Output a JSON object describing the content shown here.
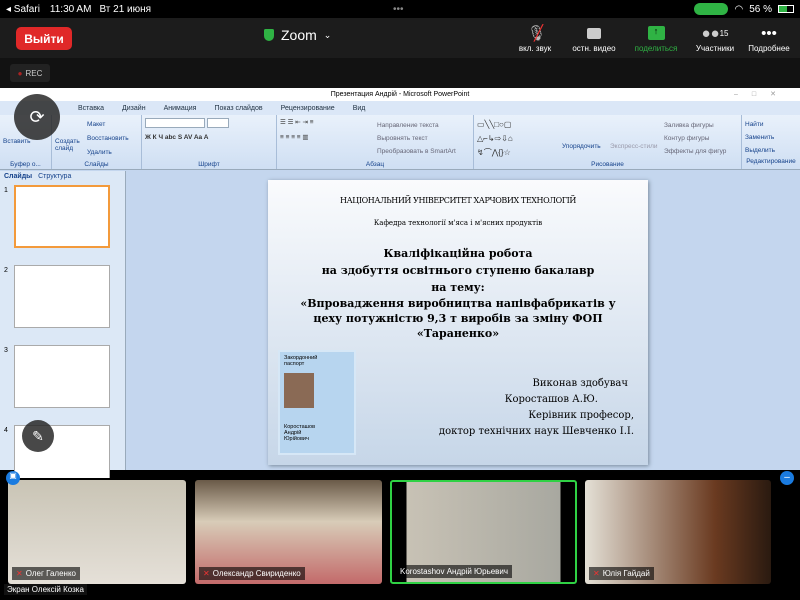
{
  "status": {
    "back": "◂ Safari",
    "time": "11:30 AM",
    "date": "Вт 21 июня",
    "battery": "56 %"
  },
  "zoom": {
    "leave": "Выйти",
    "title": "Zoom",
    "tools": [
      {
        "label": "вкл. звук",
        "icon": "mic-muted-icon"
      },
      {
        "label": "остн. видео",
        "icon": "video-icon"
      },
      {
        "label": "поделиться",
        "icon": "share-icon"
      },
      {
        "label": "Участники",
        "icon": "participants-icon",
        "badge": "15"
      },
      {
        "label": "Подробнее",
        "icon": "more-icon"
      }
    ],
    "rec": "REC"
  },
  "ppt": {
    "title": "Презентация Андрій - Microsoft PowerPoint",
    "tabs": [
      "Вставка",
      "Дизайн",
      "Анимация",
      "Показ слайдов",
      "Рецензирование",
      "Вид"
    ],
    "groups": {
      "clipboard": "Буфер о...",
      "slides": "Слайды",
      "font": "Шрифт",
      "paragraph": "Абзац",
      "drawing": "Рисование",
      "editing": "Редактирование"
    },
    "buttons": {
      "paste": "Вставить",
      "create": "Создать слайд",
      "layout": "Макет",
      "reset": "Восстановить",
      "delete": "Удалить",
      "text_dir": "Направление текста",
      "align_text": "Выровнять текст",
      "smartart": "Преобразовать в SmartArt",
      "arrange": "Упорядочить",
      "quick": "Экспресс-стили",
      "fill": "Заливка фигуры",
      "outline": "Контур фигуры",
      "effects": "Эффекты для фигур",
      "find": "Найти",
      "replace": "Заменить",
      "select": "Выделить"
    },
    "pane_tabs": [
      "Слайды",
      "Структура"
    ],
    "thumbs": [
      "1",
      "2",
      "3",
      "4"
    ]
  },
  "slide": {
    "uni": "НАЦІОНАЛЬНИЙ УНІВЕРСИТЕТ ХАРЧОВИХ ТЕХНОЛОГІЙ",
    "dept": "Кафедра технології м'яса і м'ясних продуктів",
    "l1": "Кваліфікаційна робота",
    "l2": "на здобуття освітнього ступеню бакалавр",
    "l3": "на тему:",
    "l4": "«Впровадження виробництва напівфабрикатів у",
    "l5": "цеху потужністю 9,3 т виробів за зміну ФОП",
    "l6": "«Тараненко»",
    "passport": {
      "title": "Закордонний паспорт",
      "name": "Коросташов Андрій Юрійович"
    },
    "a1": "Виконав здобувач",
    "a2": "Коросташов А.Ю.",
    "a3": "Керівник  професор,",
    "a4": "доктор технічних наук  Шевченко І.І."
  },
  "videos": [
    {
      "name": "Олег Галенко",
      "muted": true
    },
    {
      "name": "Олександр Свириденко",
      "muted": true
    },
    {
      "name": "Korostashov Андрій Юрьевич",
      "muted": false
    },
    {
      "name": "Юлія Гайдай",
      "muted": true
    }
  ],
  "screen_label": "Экран Олексій Козка"
}
